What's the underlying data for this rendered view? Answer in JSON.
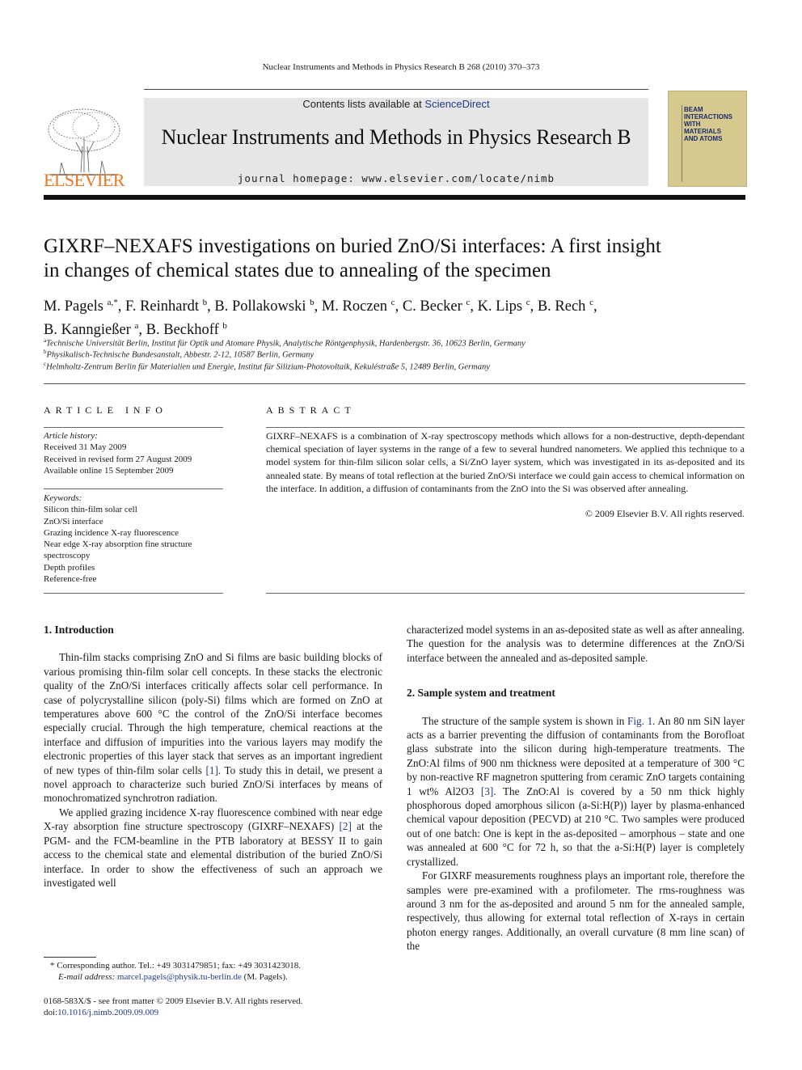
{
  "running_head": "Nuclear Instruments and Methods in Physics Research B 268 (2010) 370–373",
  "header": {
    "contents_prefix": "Contents lists available at ",
    "contents_link": "ScienceDirect",
    "journal_title": "Nuclear Instruments and Methods in Physics Research B",
    "homepage": "journal homepage: www.elsevier.com/locate/nimb",
    "publisher_logo": "ELSEVIER",
    "cover_text": [
      "BEAM",
      "INTERACTIONS",
      "WITH",
      "MATERIALS",
      "AND ATOMS"
    ],
    "colors": {
      "publisher": "#e87722",
      "link": "#1e3a8a",
      "cover": "#d6c98f"
    }
  },
  "article": {
    "title_line1": "GIXRF–NEXAFS investigations on buried ZnO/Si interfaces: A first insight",
    "title_line2": "in changes of chemical states due to annealing of the specimen",
    "authors": [
      {
        "name": "M. Pagels",
        "sup": "a,*"
      },
      {
        "name": "F. Reinhardt",
        "sup": "b"
      },
      {
        "name": "B. Pollakowski",
        "sup": "b"
      },
      {
        "name": "M. Roczen",
        "sup": "c"
      },
      {
        "name": "C. Becker",
        "sup": "c"
      },
      {
        "name": "K. Lips",
        "sup": "c"
      },
      {
        "name": "B. Rech",
        "sup": "c"
      },
      {
        "name": "B. Kanngießer",
        "sup": "a"
      },
      {
        "name": "B. Beckhoff",
        "sup": "b"
      }
    ],
    "affiliations": [
      {
        "sup": "a",
        "text": "Technische Universität Berlin, Institut für Optik und Atomare Physik, Analytische Röntgenphysik, Hardenbergstr. 36, 10623 Berlin, Germany"
      },
      {
        "sup": "b",
        "text": "Physikalisch-Technische Bundesanstalt, Abbestr. 2-12, 10587 Berlin, Germany"
      },
      {
        "sup": "c",
        "text": "Helmholtz-Zentrum Berlin für Materialien und Energie, Institut für Silizium-Photovoltaik, Kekuléstraße 5, 12489 Berlin, Germany"
      }
    ]
  },
  "article_info": {
    "heading": "ARTICLE INFO",
    "history_label": "Article history:",
    "history": [
      "Received 31 May 2009",
      "Received in revised form 27 August 2009",
      "Available online 15 September 2009"
    ],
    "keywords_label": "Keywords:",
    "keywords": [
      "Silicon thin-film solar cell",
      "ZnO/Si interface",
      "Grazing incidence X-ray fluorescence",
      "Near edge X-ray absorption fine structure",
      "spectroscopy",
      "Depth profiles",
      "Reference-free"
    ]
  },
  "abstract": {
    "heading": "ABSTRACT",
    "text": "GIXRF–NEXAFS is a combination of X-ray spectroscopy methods which allows for a non-destructive, depth-dependant chemical speciation of layer systems in the range of a few to several hundred nanometers. We applied this technique to a model system for thin-film silicon solar cells, a Si/ZnO layer system, which was investigated in its as-deposited and its annealed state. By means of total reflection at the buried ZnO/Si interface we could gain access to chemical information on the interface. In addition, a diffusion of contaminants from the ZnO into the Si was observed after annealing.",
    "copyright": "© 2009 Elsevier B.V. All rights reserved."
  },
  "body": {
    "sec1_heading": "1. Introduction",
    "sec1_p1_a": "Thin-film stacks comprising ZnO and Si films are basic building blocks of various promising thin-film solar cell concepts. In these stacks the electronic quality of the ZnO/Si interfaces critically affects solar cell performance. In case of polycrystalline silicon (poly-Si) films which are formed on ZnO at temperatures above 600 °C the control of the ZnO/Si interface becomes especially crucial. Through the high temperature, chemical reactions at the interface and diffusion of impurities into the various layers may modify the electronic properties of this layer stack that serves as an important ingredient of new types of thin-film solar cells ",
    "sec1_p1_ref": "[1]",
    "sec1_p1_b": ". To study this in detail, we present a novel approach to characterize such buried ZnO/Si interfaces by means of monochromatized synchrotron radiation.",
    "sec1_p2_a": "We applied grazing incidence X-ray fluorescence combined with near edge X-ray absorption fine structure spectroscopy (GIXRF–NEXAFS) ",
    "sec1_p2_ref": "[2]",
    "sec1_p2_b": " at the PGM- and the FCM-beamline in the PTB laboratory at BESSY II to gain access to the chemical state and elemental distribution of the buried ZnO/Si interface. In order to show the effectiveness of such an approach we investigated well",
    "col2_cont": "characterized model systems in an as-deposited state as well as after annealing. The question for the analysis was to determine differences at the ZnO/Si interface between the annealed and as-deposited sample.",
    "sec2_heading": "2. Sample system and treatment",
    "sec2_p1_a": "The structure of the sample system is shown in ",
    "sec2_p1_fig": "Fig. 1",
    "sec2_p1_b": ". An 80 nm SiN layer acts as a barrier preventing the diffusion of contaminants from the Borofloat glass substrate into the silicon during high-temperature treatments. The ZnO:Al films of 900 nm thickness were deposited at a temperature of 300 °C by non-reactive RF magnetron sputtering from ceramic ZnO targets containing 1 wt% Al2O3 ",
    "sec2_p1_ref": "[3]",
    "sec2_p1_c": ". The ZnO:Al is covered by a 50 nm thick highly phosphorous doped amorphous silicon (a-Si:H(P)) layer by plasma-enhanced chemical vapour deposition (PECVD) at 210 °C. Two samples were produced out of one batch: One is kept in the as-deposited – amorphous – state and one was annealed at 600 °C for 72 h, so that the a-Si:H(P) layer is completely crystallized.",
    "sec2_p2": "For GIXRF measurements roughness plays an important role, therefore the samples were pre-examined with a profilometer. The rms-roughness was around 3 nm for the as-deposited and around 5 nm for the annealed sample, respectively, thus allowing for external total reflection of X-rays in certain photon energy ranges. Additionally, an overall curvature (8 mm line scan) of the"
  },
  "footnotes": {
    "corresponding": "* Corresponding author. Tel.: +49 3031479851; fax: +49 3031423018.",
    "email_label": "E-mail address: ",
    "email": "marcel.pagels@physik.tu-berlin.de",
    "email_suffix": " (M. Pagels).",
    "issn": "0168-583X/$ - see front matter © 2009 Elsevier B.V. All rights reserved.",
    "doi_label": "doi:",
    "doi": "10.1016/j.nimb.2009.09.009"
  }
}
